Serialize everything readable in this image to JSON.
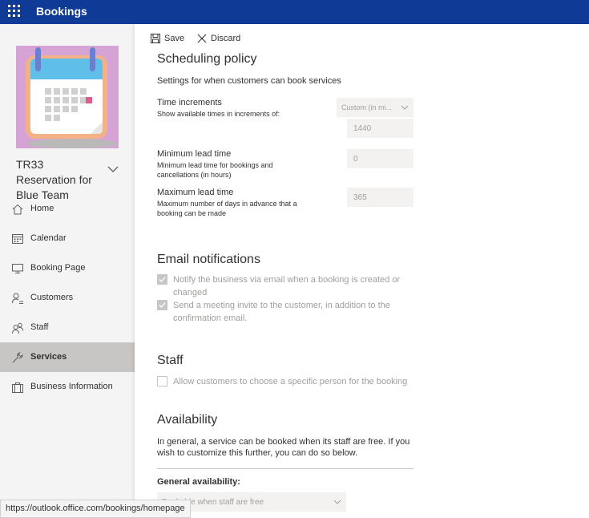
{
  "app": {
    "title": "Bookings"
  },
  "sidebar": {
    "business_name": "TR33 Reservation for Blue Team",
    "nav": [
      {
        "label": "Home",
        "icon": "home-icon"
      },
      {
        "label": "Calendar",
        "icon": "calendar-icon"
      },
      {
        "label": "Booking Page",
        "icon": "monitor-icon"
      },
      {
        "label": "Customers",
        "icon": "customers-icon"
      },
      {
        "label": "Staff",
        "icon": "staff-icon"
      },
      {
        "label": "Services",
        "icon": "wrench-icon",
        "active": true
      },
      {
        "label": "Business Information",
        "icon": "briefcase-icon"
      }
    ]
  },
  "toolbar": {
    "save_label": "Save",
    "discard_label": "Discard"
  },
  "scheduling": {
    "title": "Scheduling policy",
    "subtitle": "Settings for when customers can book services",
    "time_increments": {
      "label": "Time increments",
      "desc": "Show available times in increments of:",
      "dropdown_value": "Custom (in mi...",
      "value": "1440"
    },
    "min_lead": {
      "label": "Minimum lead time",
      "desc": "Minimum lead time for bookings and cancellations (in hours)",
      "value": "0"
    },
    "max_lead": {
      "label": "Maximum lead time",
      "desc": "Maximum number of days in advance that a booking can be made",
      "value": "365"
    }
  },
  "email": {
    "title": "Email notifications",
    "notify_business": {
      "label": "Notify the business via email when a booking is created or changed",
      "checked": true
    },
    "meeting_invite": {
      "label": "Send a meeting invite to the customer, in addition to the confirmation email.",
      "checked": true
    }
  },
  "staff": {
    "title": "Staff",
    "choose_person": {
      "label": "Allow customers to choose a specific person for the booking",
      "checked": false
    }
  },
  "availability": {
    "title": "Availability",
    "desc": "In general, a service can be booked when its staff are free. If you wish to customize this further, you can do so below.",
    "general_label": "General availability:",
    "general_value": "Bookable when staff are free"
  },
  "status_url": "https://outlook.office.com/bookings/homepage",
  "colors": {
    "topbar": "#0f3a96",
    "active_nav": "#c8c6c4",
    "logo_bg": "#d6a4d4"
  }
}
